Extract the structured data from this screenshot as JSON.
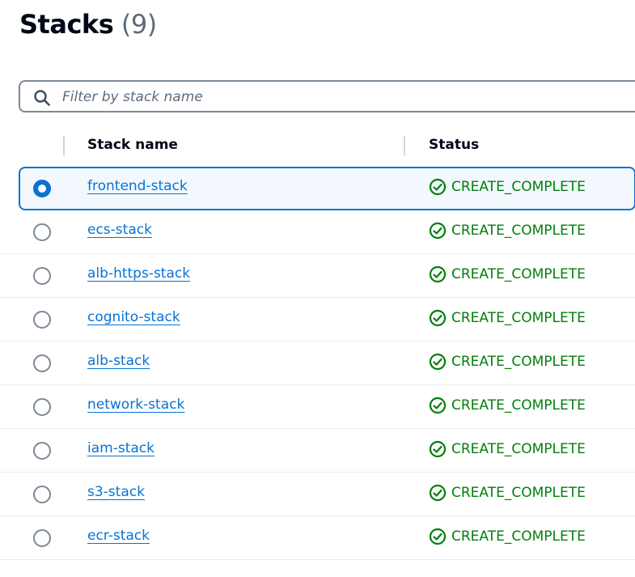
{
  "header": {
    "title": "Stacks",
    "count": "(9)"
  },
  "filter": {
    "placeholder": "Filter by stack name",
    "value": ""
  },
  "table": {
    "columns": [
      "Stack name",
      "Status"
    ],
    "rows": [
      {
        "name": "frontend-stack",
        "status": "CREATE_COMPLETE",
        "selected": true
      },
      {
        "name": "ecs-stack",
        "status": "CREATE_COMPLETE",
        "selected": false
      },
      {
        "name": "alb-https-stack",
        "status": "CREATE_COMPLETE",
        "selected": false
      },
      {
        "name": "cognito-stack",
        "status": "CREATE_COMPLETE",
        "selected": false
      },
      {
        "name": "alb-stack",
        "status": "CREATE_COMPLETE",
        "selected": false
      },
      {
        "name": "network-stack",
        "status": "CREATE_COMPLETE",
        "selected": false
      },
      {
        "name": "iam-stack",
        "status": "CREATE_COMPLETE",
        "selected": false
      },
      {
        "name": "s3-stack",
        "status": "CREATE_COMPLETE",
        "selected": false
      },
      {
        "name": "ecr-stack",
        "status": "CREATE_COMPLETE",
        "selected": false
      }
    ]
  },
  "icons": {
    "search": "search-icon",
    "status_ok": "status-success-icon"
  },
  "colors": {
    "link": "#0972d3",
    "success": "#037f0c",
    "selected_bg": "#f2f8fd",
    "text": "#000716"
  }
}
